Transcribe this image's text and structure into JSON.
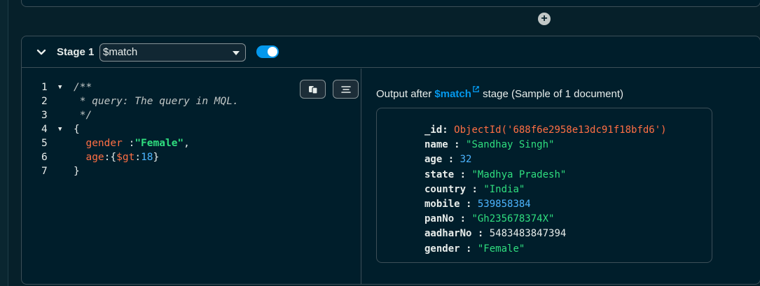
{
  "add_stage": {
    "icon": "plus-circle-icon"
  },
  "stage": {
    "label": "Stage 1",
    "operator": "$match",
    "enabled": true
  },
  "editor": {
    "lines": [
      {
        "n": "1",
        "fold": true,
        "parts": [
          {
            "t": "/**",
            "c": "c-comment"
          }
        ]
      },
      {
        "n": "2",
        "fold": false,
        "parts": [
          {
            "t": " * query: The query in MQL.",
            "c": "c-comment"
          }
        ]
      },
      {
        "n": "3",
        "fold": false,
        "parts": [
          {
            "t": " */",
            "c": "c-comment"
          }
        ]
      },
      {
        "n": "4",
        "fold": true,
        "parts": [
          {
            "t": "{",
            "c": "c-punct"
          }
        ]
      },
      {
        "n": "5",
        "fold": false,
        "parts": [
          {
            "t": "  gender ",
            "c": "c-key"
          },
          {
            "t": ":",
            "c": "c-punct"
          },
          {
            "t": "\"Female\"",
            "c": "c-str"
          },
          {
            "t": ",",
            "c": "c-punct"
          }
        ]
      },
      {
        "n": "6",
        "fold": false,
        "parts": [
          {
            "t": "  age",
            "c": "c-key"
          },
          {
            "t": ":{",
            "c": "c-punct"
          },
          {
            "t": "$gt",
            "c": "c-op"
          },
          {
            "t": ":",
            "c": "c-punct"
          },
          {
            "t": "18",
            "c": "c-num"
          },
          {
            "t": "}",
            "c": "c-punct"
          }
        ]
      },
      {
        "n": "7",
        "fold": false,
        "parts": [
          {
            "t": "}",
            "c": "c-punct"
          }
        ]
      }
    ],
    "buttons": [
      "copy-icon",
      "format-icon"
    ]
  },
  "output": {
    "prefix": "Output after",
    "link": "$match",
    "suffix": " stage (Sample of 1 document)",
    "fields": [
      {
        "key": "_id",
        "sep": ": ",
        "value": "ObjectId('688f6e2958e13dc91f18bfd6')",
        "type": "oid"
      },
      {
        "key": "name",
        "sep": " : ",
        "value": "\"Sandhay Singh\"",
        "type": "str"
      },
      {
        "key": "age",
        "sep": " : ",
        "value": "32",
        "type": "num"
      },
      {
        "key": "state",
        "sep": " : ",
        "value": "\"Madhya Pradesh\"",
        "type": "str"
      },
      {
        "key": "country",
        "sep": " : ",
        "value": "\"India\"",
        "type": "str"
      },
      {
        "key": "mobile",
        "sep": " : ",
        "value": "539858384",
        "type": "num"
      },
      {
        "key": "panNo",
        "sep": " : ",
        "value": "\"Gh235678374X\"",
        "type": "str"
      },
      {
        "key": "aadharNo",
        "sep": " : ",
        "value": "5483483847394",
        "type": "plain"
      },
      {
        "key": "gender",
        "sep": " : ",
        "value": "\"Female\"",
        "type": "str"
      }
    ]
  },
  "colors": {
    "accent": "#0498ec",
    "string": "#2fde7f",
    "key": "#ff6f44",
    "number": "#4db5ff"
  }
}
